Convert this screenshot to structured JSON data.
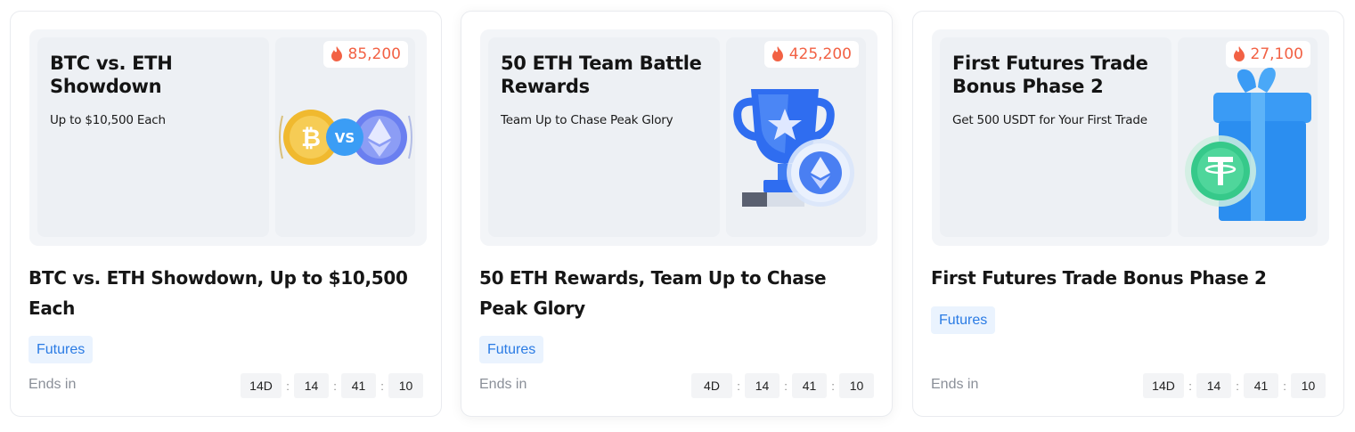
{
  "cards": [
    {
      "banner_title": "BTC vs. ETH\nShowdown",
      "banner_title_l1": "BTC vs. ETH",
      "banner_title_l2": "Showdown",
      "banner_subtitle": "Up to $10,500 Each",
      "hot_count": "85,200",
      "art_icon": "btc-vs-eth-coins",
      "title": "BTC vs. ETH Showdown, Up to $10,500 Each",
      "tag": "Futures",
      "ends_label": "Ends in",
      "countdown": {
        "days": "14D",
        "hours": "14",
        "minutes": "41",
        "seconds": "10"
      }
    },
    {
      "banner_title_l1": "50 ETH Team Battle",
      "banner_title_l2": "Rewards",
      "banner_subtitle": "Team Up to Chase Peak Glory",
      "hot_count": "425,200",
      "art_icon": "trophy-eth-coin",
      "title": "50 ETH Rewards, Team Up to Chase Peak Glory",
      "tag": "Futures",
      "ends_label": "Ends in",
      "countdown": {
        "days": "4D",
        "hours": "14",
        "minutes": "41",
        "seconds": "10"
      }
    },
    {
      "banner_title_l1": "First Futures Trade",
      "banner_title_l2": "Bonus Phase 2",
      "banner_subtitle": "Get 500 USDT for Your First Trade",
      "hot_count": "27,100",
      "art_icon": "gift-usdt-coin",
      "title": "First Futures Trade Bonus Phase 2",
      "tag": "Futures",
      "ends_label": "Ends in",
      "countdown": {
        "days": "14D",
        "hours": "14",
        "minutes": "41",
        "seconds": "10"
      }
    }
  ],
  "colors": {
    "hot": "#f26144",
    "tag_text": "#2a7be4",
    "tag_bg": "#eaf3fe",
    "btc": "#f0b92f",
    "eth": "#6a7ff0",
    "vs": "#3b9df5",
    "trophy": "#2f6df0",
    "gift": "#2b8ef0",
    "usdt": "#36c98a"
  }
}
